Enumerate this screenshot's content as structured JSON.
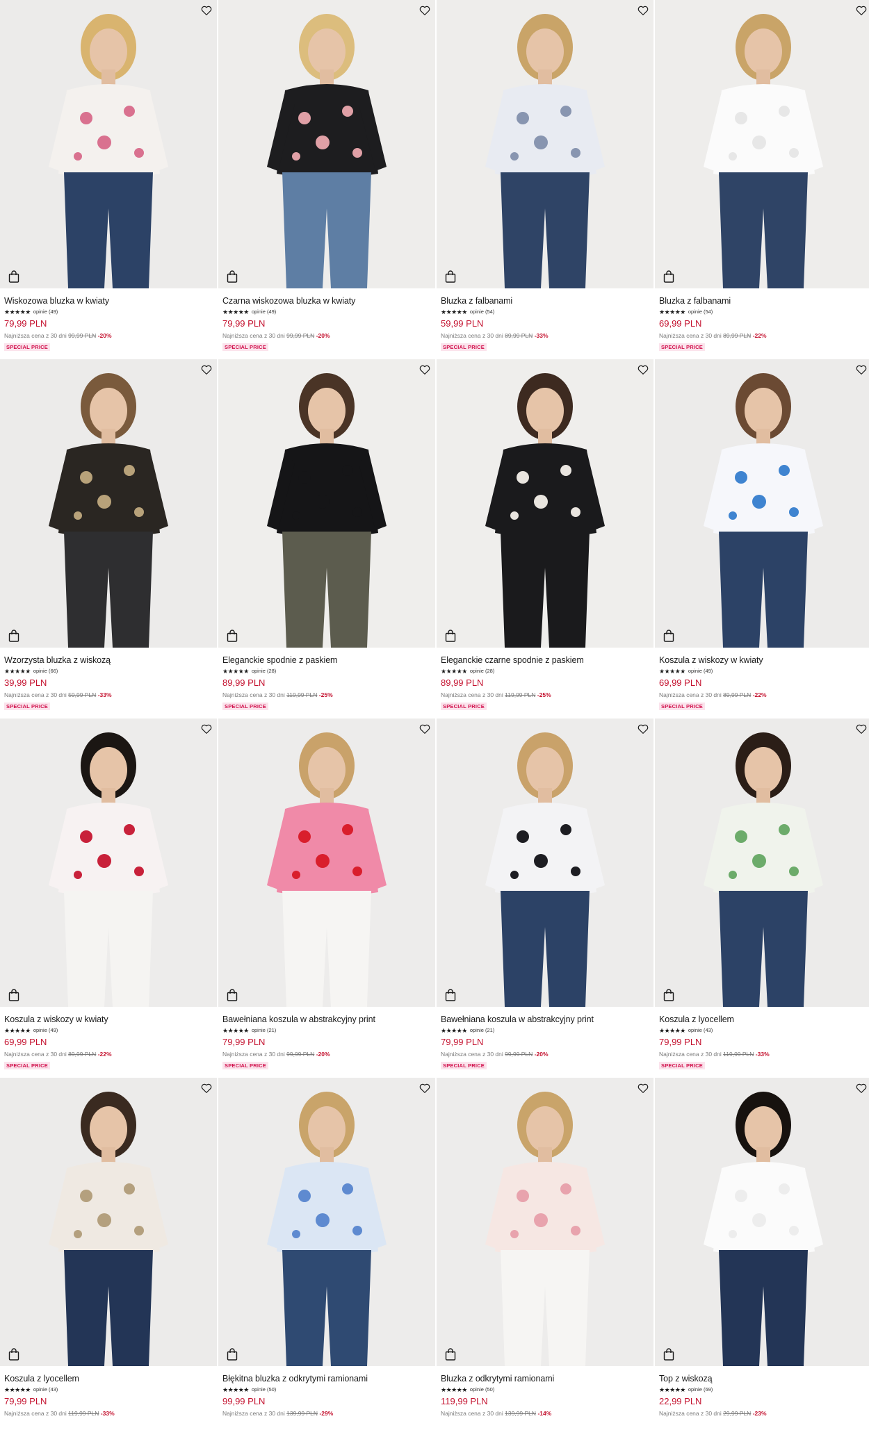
{
  "products": [
    {
      "name": "Wiskozowa bluzka w kwiaty",
      "stars": "★★★★★",
      "reviews": "opinie (49)",
      "price": "79,99 PLN",
      "lowest_prefix": "Najniższa cena z 30 dni",
      "lowest_old": "99,99 PLN",
      "discount": "-20%",
      "badge": "SPECIAL PRICE",
      "top": "#f4f1ee",
      "top_pattern": "#d9718f",
      "bottom": "#2c4266",
      "hair": "#d9b46f",
      "bg": "#ecebea"
    },
    {
      "name": "Czarna wiskozowa bluzka w kwiaty",
      "stars": "★★★★★",
      "reviews": "opinie (49)",
      "price": "79,99 PLN",
      "lowest_prefix": "Najniższa cena z 30 dni",
      "lowest_old": "99,99 PLN",
      "discount": "-20%",
      "badge": "SPECIAL PRICE",
      "top": "#1d1d1f",
      "top_pattern": "#e0a0a6",
      "bottom": "#5e7ea4",
      "hair": "#dcbd7d",
      "bg": "#eeedeb"
    },
    {
      "name": "Bluzka z falbanami",
      "stars": "★★★★★",
      "reviews": "opinie (54)",
      "price": "59,99 PLN",
      "lowest_prefix": "Najniższa cena z 30 dni",
      "lowest_old": "89,99 PLN",
      "discount": "-33%",
      "badge": "SPECIAL PRICE",
      "top": "#e8ebf2",
      "top_pattern": "#8895b0",
      "bottom": "#2f4466",
      "hair": "#c9a468",
      "bg": "#eeedeb"
    },
    {
      "name": "Bluzka z falbanami",
      "stars": "★★★★★",
      "reviews": "opinie (54)",
      "price": "69,99 PLN",
      "lowest_prefix": "Najniższa cena z 30 dni",
      "lowest_old": "89,99 PLN",
      "discount": "-22%",
      "badge": "SPECIAL PRICE",
      "top": "#fbfbfb",
      "top_pattern": "#e7e7e7",
      "bottom": "#2f4466",
      "hair": "#c9a468",
      "bg": "#eeedeb"
    },
    {
      "name": "Wzorzysta bluzka z wiskozą",
      "stars": "★★★★★",
      "reviews": "opinie (66)",
      "price": "39,99 PLN",
      "lowest_prefix": "Najniższa cena z 30 dni",
      "lowest_old": "59,99 PLN",
      "discount": "-33%",
      "badge": "SPECIAL PRICE",
      "top": "#2a2622",
      "top_pattern": "#b8a27a",
      "bottom": "#2e2e30",
      "hair": "#7a5a3c",
      "bg": "#ecebea"
    },
    {
      "name": "Eleganckie spodnie z paskiem",
      "stars": "★★★★★",
      "reviews": "opinie (28)",
      "price": "89,99 PLN",
      "lowest_prefix": "Najniższa cena z 30 dni",
      "lowest_old": "119,99 PLN",
      "discount": "-25%",
      "badge": "SPECIAL PRICE",
      "top": "#151517",
      "top_pattern": "#151517",
      "bottom": "#5c5c4e",
      "hair": "#4a3426",
      "bg": "#efeeec"
    },
    {
      "name": "Eleganckie czarne spodnie z paskiem",
      "stars": "★★★★★",
      "reviews": "opinie (28)",
      "price": "89,99 PLN",
      "lowest_prefix": "Najniższa cena z 30 dni",
      "lowest_old": "119,99 PLN",
      "discount": "-25%",
      "badge": "SPECIAL PRICE",
      "top": "#1a1a1c",
      "top_pattern": "#e9e5df",
      "bottom": "#1a1a1c",
      "hair": "#3d2a20",
      "bg": "#efeeec"
    },
    {
      "name": "Koszula z wiskozy w kwiaty",
      "stars": "★★★★★",
      "reviews": "opinie (49)",
      "price": "69,99 PLN",
      "lowest_prefix": "Najniższa cena z 30 dni",
      "lowest_old": "89,99 PLN",
      "discount": "-22%",
      "badge": "SPECIAL PRICE",
      "top": "#f6f7fb",
      "top_pattern": "#3f84d0",
      "bottom": "#2c4266",
      "hair": "#6b4a33",
      "bg": "#ecebea"
    },
    {
      "name": "Koszula z wiskozy w kwiaty",
      "stars": "★★★★★",
      "reviews": "opinie (49)",
      "price": "69,99 PLN",
      "lowest_prefix": "Najniższa cena z 30 dni",
      "lowest_old": "89,99 PLN",
      "discount": "-22%",
      "badge": "SPECIAL PRICE",
      "top": "#f7f2f2",
      "top_pattern": "#c8213a",
      "bottom": "#f5f4f2",
      "hair": "#1b1613",
      "bg": "#edeceb"
    },
    {
      "name": "Bawełniana koszula w abstrakcyjny print",
      "stars": "★★★★★",
      "reviews": "opinie (21)",
      "price": "79,99 PLN",
      "lowest_prefix": "Najniższa cena z 30 dni",
      "lowest_old": "99,99 PLN",
      "discount": "-20%",
      "badge": "SPECIAL PRICE",
      "top": "#f08aa8",
      "top_pattern": "#d91e2c",
      "bottom": "#f6f5f3",
      "hair": "#c9a26a",
      "bg": "#edeceb"
    },
    {
      "name": "Bawełniana koszula w abstrakcyjny print",
      "stars": "★★★★★",
      "reviews": "opinie (21)",
      "price": "79,99 PLN",
      "lowest_prefix": "Najniższa cena z 30 dni",
      "lowest_old": "99,99 PLN",
      "discount": "-20%",
      "badge": "SPECIAL PRICE",
      "top": "#f3f3f5",
      "top_pattern": "#1d1d22",
      "bottom": "#2c4266",
      "hair": "#c9a26a",
      "bg": "#edeceb"
    },
    {
      "name": "Koszula z lyocellem",
      "stars": "★★★★★",
      "reviews": "opinie (43)",
      "price": "79,99 PLN",
      "lowest_prefix": "Najniższa cena z 30 dni",
      "lowest_old": "119,99 PLN",
      "discount": "-33%",
      "badge": "SPECIAL PRICE",
      "top": "#f0f3ec",
      "top_pattern": "#6cab6a",
      "bottom": "#2c4266",
      "hair": "#2b1e17",
      "bg": "#ecebea"
    },
    {
      "name": "Koszula z lyocellem",
      "stars": "★★★★★",
      "reviews": "opinie (43)",
      "price": "79,99 PLN",
      "lowest_prefix": "Najniższa cena z 30 dni",
      "lowest_old": "119,99 PLN",
      "discount": "-33%",
      "badge": "",
      "top": "#efe9e2",
      "top_pattern": "#b4a07e",
      "bottom": "#233556",
      "hair": "#3a2a20",
      "bg": "#ecebea"
    },
    {
      "name": "Błękitna bluzka z odkrytymi ramionami",
      "stars": "★★★★★",
      "reviews": "opinie (50)",
      "price": "99,99 PLN",
      "lowest_prefix": "Najniższa cena z 30 dni",
      "lowest_old": "139,99 PLN",
      "discount": "-29%",
      "badge": "",
      "top": "#dbe6f4",
      "top_pattern": "#5e8ad0",
      "bottom": "#2f4a72",
      "hair": "#c9a46a",
      "bg": "#edeceb"
    },
    {
      "name": "Bluzka z odkrytymi ramionami",
      "stars": "★★★★★",
      "reviews": "opinie (50)",
      "price": "119,99 PLN",
      "lowest_prefix": "Najniższa cena z 30 dni",
      "lowest_old": "139,99 PLN",
      "discount": "-14%",
      "badge": "",
      "top": "#f6e7e3",
      "top_pattern": "#e8a3ad",
      "bottom": "#f6f5f3",
      "hair": "#c9a46a",
      "bg": "#edeceb"
    },
    {
      "name": "Top z wiskozą",
      "stars": "★★★★★",
      "reviews": "opinie (69)",
      "price": "22,99 PLN",
      "lowest_prefix": "Najniższa cena z 30 dni",
      "lowest_old": "29,99 PLN",
      "discount": "-23%",
      "badge": "",
      "top": "#fbfbfb",
      "top_pattern": "#ededed",
      "bottom": "#233556",
      "hair": "#17120f",
      "bg": "#ecebea"
    }
  ]
}
